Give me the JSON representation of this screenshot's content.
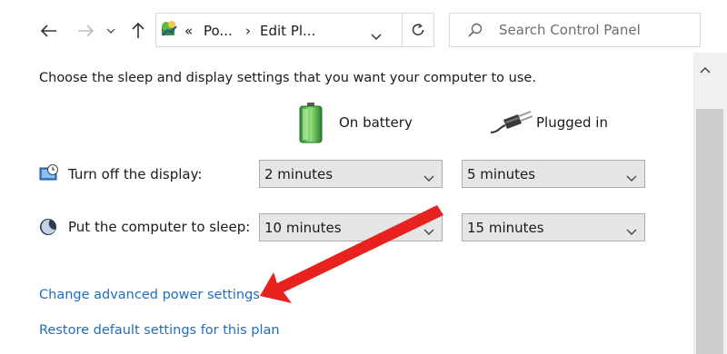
{
  "nav": {
    "breadcrumb_overflow": "«",
    "crumb1": "Po...",
    "separator": "›",
    "crumb2": "Edit Pl...",
    "search_placeholder": "Search Control Panel"
  },
  "main": {
    "intro": "Choose the sleep and display settings that you want your computer to use.",
    "col_battery": "On battery",
    "col_plugged": "Plugged in",
    "rows": [
      {
        "label": "Turn off the display:",
        "battery": "2 minutes",
        "plugged": "5 minutes"
      },
      {
        "label": "Put the computer to sleep:",
        "battery": "10 minutes",
        "plugged": "15 minutes"
      }
    ],
    "link_advanced": "Change advanced power settings",
    "link_restore": "Restore default settings for this plan"
  },
  "annotation": {
    "arrow_color": "#e8221e"
  }
}
